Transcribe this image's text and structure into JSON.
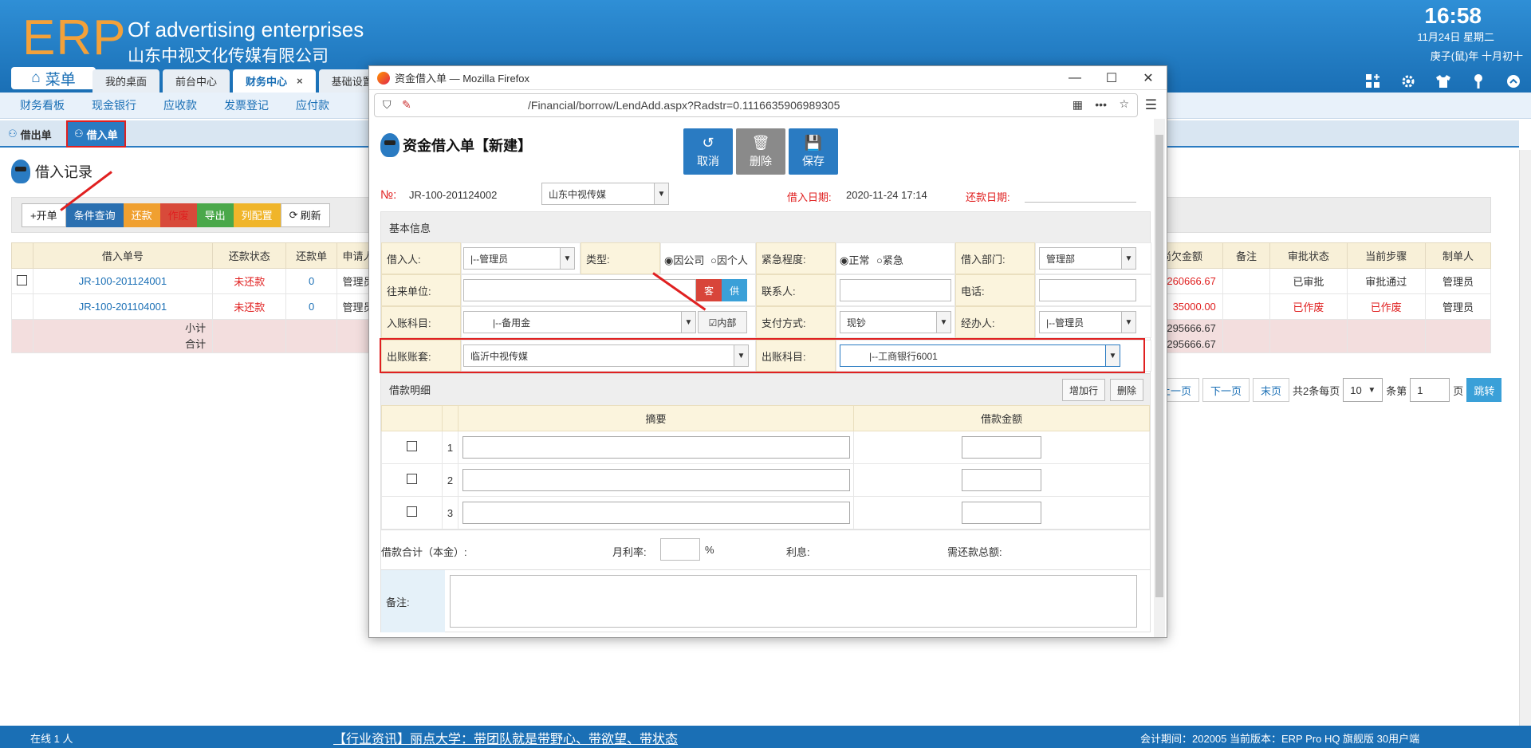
{
  "header": {
    "logo": "ERP",
    "brand_en": "Of advertising enterprises",
    "brand_cn": "山东中视文化传媒有限公司",
    "clock": "16:58",
    "date": "11月24日 星期二",
    "lunar": "庚子(鼠)年 十月初十",
    "menu_label": "菜单",
    "tabs": [
      "我的桌面",
      "前台中心",
      "财务中心",
      "基础设置"
    ],
    "tab_close": "×"
  },
  "subnav": [
    "财务看板",
    "现金银行",
    "应收款",
    "发票登记",
    "应付款"
  ],
  "pagetabs": [
    "借出单",
    "借入单"
  ],
  "page": {
    "title": "借入记录",
    "toolbar": [
      "+开单",
      "条件查询",
      "还款",
      "作废",
      "导出",
      "列配置",
      "刷新"
    ],
    "columns": [
      "借入单号",
      "还款状态",
      "还款单",
      "申请人",
      "尚欠金额",
      "备注",
      "审批状态",
      "当前步骤",
      "制单人"
    ],
    "rows": [
      {
        "no": "JR-100-201124001",
        "status": "未还款",
        "repay": "0",
        "applicant": "管理员",
        "owed": "260666.67",
        "note": "",
        "approval": "已审批",
        "step": "审批通过",
        "maker": "管理员"
      },
      {
        "no": "JR-100-201104001",
        "status": "未还款",
        "repay": "0",
        "applicant": "管理员",
        "owed": "35000.00",
        "note": "",
        "approval": "已作废",
        "step": "已作废",
        "maker": "管理员"
      }
    ],
    "subtotal_label": "小计",
    "total_label": "合计",
    "subtotal_val": "295666.67",
    "total_val": "295666.67",
    "pager": {
      "prev": "上一页",
      "next": "下一页",
      "last": "末页",
      "info": "共2条每页",
      "size": "10",
      "items": "条第",
      "page": "1",
      "page_unit": "页",
      "jump": "跳转"
    }
  },
  "status_bar": {
    "online": "在线  1  人",
    "news": "【行业资讯】丽点大学：带团队就是带野心、带欲望、带状态",
    "right": "会计期间：202005 当前版本：ERP Pro HQ 旗舰版 30用户端"
  },
  "popup": {
    "window_title": "资金借入单 — Mozilla Firefox",
    "url": "/Financial/borrow/LendAdd.aspx?Radstr=0.1116635906989305",
    "doc_title": "资金借入单【新建】",
    "btn_cancel": "取消",
    "btn_delete": "删除",
    "btn_save": "保存",
    "no_label": "№:",
    "no_value": "JR-100-201124002",
    "company": "山东中视传媒",
    "borrow_date_label": "借入日期:",
    "borrow_date": "2020-11-24 17:14",
    "repay_date_label": "还款日期:",
    "basic_title": "基本信息",
    "f_borrower": "借入人:",
    "v_borrower": "|--管理员",
    "f_type": "类型:",
    "v_type_a": "◉因公司",
    "v_type_b": "○因个人",
    "f_urgency": "紧急程度:",
    "v_urg_a": "◉正常",
    "v_urg_b": "○紧急",
    "f_dept": "借入部门:",
    "v_dept": "管理部",
    "f_partner": "往来单位:",
    "btn_customer": "客",
    "btn_supplier": "供",
    "f_contact": "联系人:",
    "f_phone": "电话:",
    "f_in_subject": "入账科目:",
    "v_in_subject": "|--备用金",
    "v_internal": "☑内部",
    "f_pay": "支付方式:",
    "v_pay": "现钞",
    "f_handler": "经办人:",
    "v_handler": "|--管理员",
    "f_out_set": "出账账套:",
    "v_out_set": "临沂中视传媒",
    "f_out_subject": "出账科目:",
    "v_out_subject": "|--工商银行6001",
    "detail_title": "借款明细",
    "btn_addrow": "增加行",
    "btn_delrow": "删除",
    "col_summary": "摘要",
    "col_amount": "借款金额",
    "line_nos": [
      "1",
      "2",
      "3"
    ],
    "sum_label": "借款合计（本金）:",
    "rate_label": "月利率:",
    "rate_unit": "%",
    "interest_label": "利息:",
    "total_repay_label": "需还款总额:",
    "note_label": "备注:"
  },
  "colors": {
    "header": "#1a6fb5",
    "accent": "#2a7bc2",
    "alert": "#e02020",
    "logo": "#f3a13a"
  }
}
